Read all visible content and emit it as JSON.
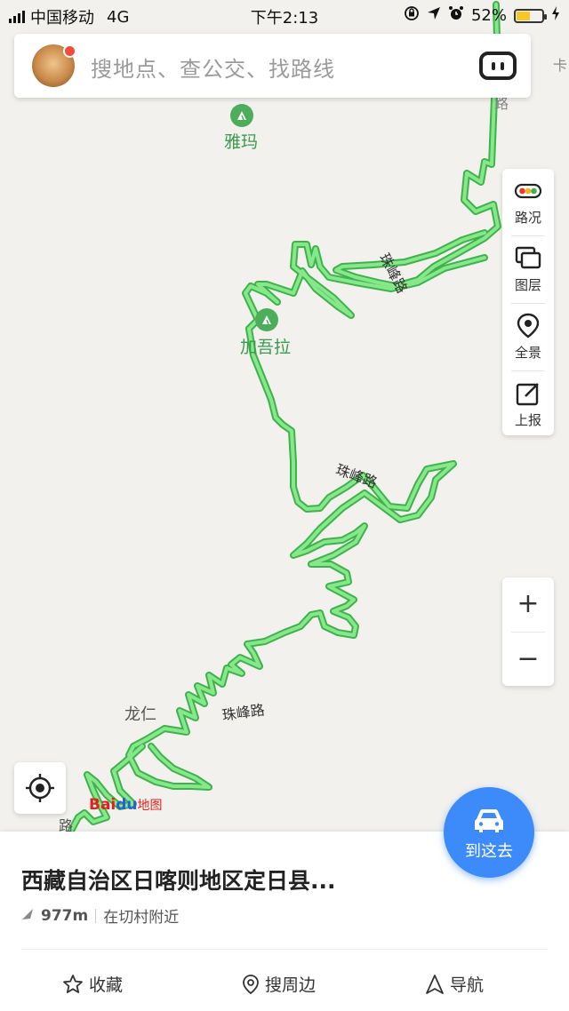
{
  "status_bar": {
    "carrier": "中国移动",
    "network": "4G",
    "time": "下午2:13",
    "battery": "52%",
    "battery_level": 0.52
  },
  "search": {
    "placeholder": "搜地点、查公交、找路线",
    "avatar_icon": "avatar",
    "voice_icon": "voice-assistant-icon"
  },
  "tools": [
    {
      "label": "路况",
      "icon": "traffic-light-icon"
    },
    {
      "label": "图层",
      "icon": "layers-icon"
    },
    {
      "label": "全景",
      "icon": "panorama-pin-icon"
    },
    {
      "label": "上报",
      "icon": "report-edit-icon"
    }
  ],
  "zoom": {
    "in": "+",
    "out": "−"
  },
  "map": {
    "places": {
      "yama": "雅玛",
      "jiawula": "加吾拉",
      "longren": "龙仁"
    },
    "roads": {
      "name": "珠峰路",
      "partial_top": "路",
      "partial_right": "卡",
      "partial_left": "路"
    },
    "route_color": "#67d96f",
    "logo": {
      "bai": "Bai",
      "du": "du",
      "map": "地图"
    }
  },
  "place_sheet": {
    "title": "西藏自治区日喀则地区定日县...",
    "distance": "977m",
    "near": "在切村附近",
    "actions": {
      "favorite": "收藏",
      "nearby": "搜周边",
      "navigate": "导航"
    }
  },
  "go_button": {
    "label": "到这去",
    "icon": "car-icon",
    "color": "#3d8bfb"
  }
}
